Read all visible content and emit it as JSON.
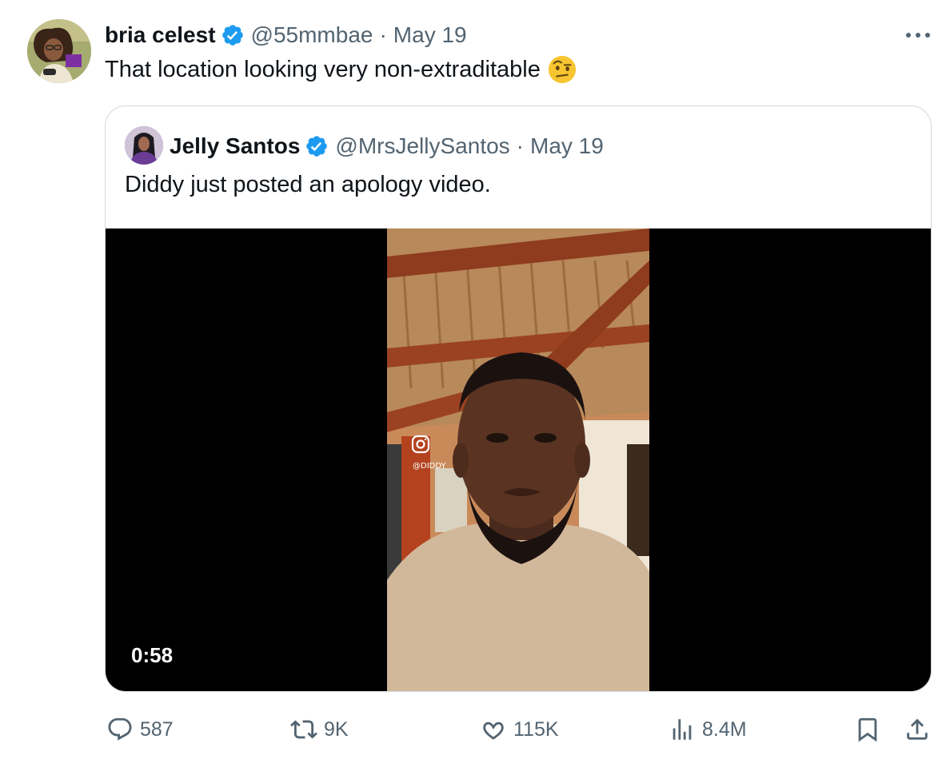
{
  "author": {
    "name": "bria celest",
    "handle": "@55mmbae",
    "separator": "·",
    "date": "May 19",
    "text": "That location looking very non-extraditable",
    "emoji": "face-with-raised-eyebrow"
  },
  "quoted": {
    "name": "Jelly Santos",
    "handle": "@MrsJellySantos",
    "separator": "·",
    "date": "May 19",
    "text": "Diddy just posted an apology video.",
    "watermark": "@DIDDY",
    "video_duration": "0:58"
  },
  "actions": {
    "replies": "587",
    "reposts": "9K",
    "likes": "115K",
    "views": "8.4M"
  },
  "colors": {
    "verified": "#1d9bf0",
    "muted": "#536471",
    "border": "#cfd9de"
  }
}
